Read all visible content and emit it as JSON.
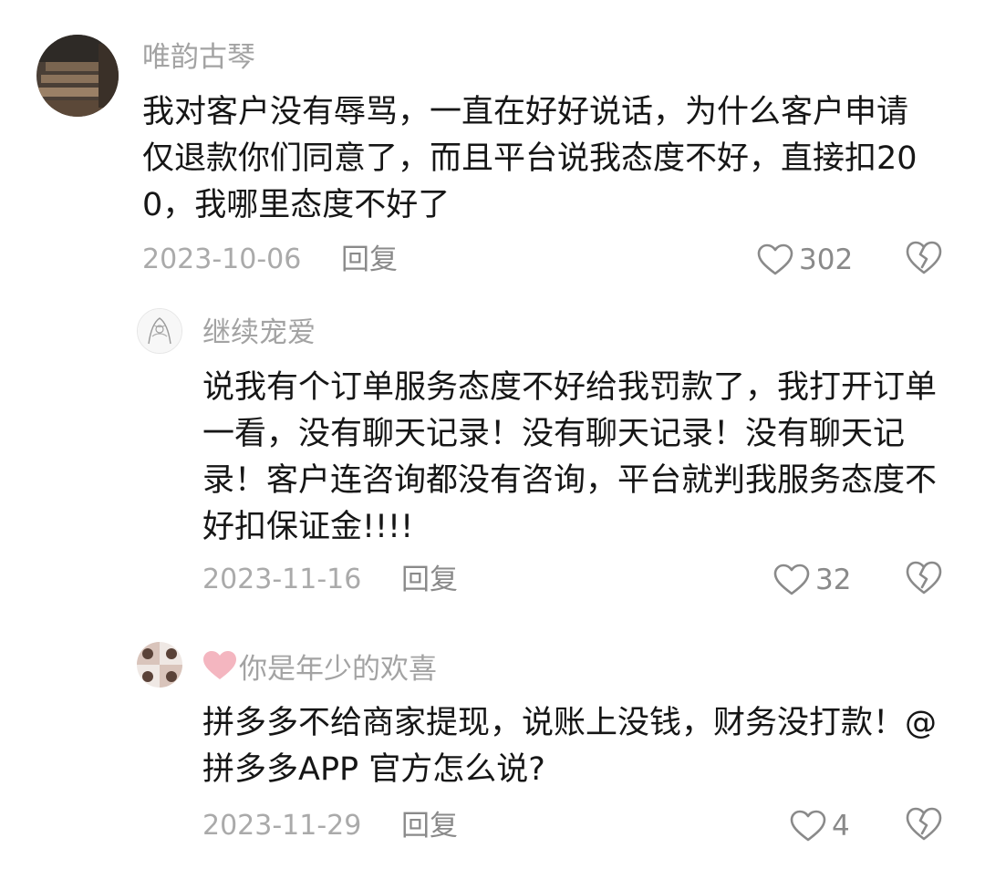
{
  "comments": [
    {
      "username": "唯韵古琴",
      "text": "我对客户没有辱骂，一直在好好说话，为什么客户申请仅退款你们同意了，而且平台说我态度不好，直接扣200，我哪里态度不好了",
      "date": "2023-10-06",
      "reply_label": "回复",
      "likes": "302"
    },
    {
      "username": "继续宠爱",
      "text": "说我有个订单服务态度不好给我罚款了，我打开订单一看，没有聊天记录！没有聊天记录！没有聊天记录！客户连咨询都没有咨询，平台就判我服务态度不好扣保证金!!!!",
      "date": "2023-11-16",
      "reply_label": "回复",
      "likes": "32"
    },
    {
      "username": "你是年少的欢喜",
      "text": "拼多多不给商家提现，说账上没钱，财务没打款！@拼多多APP 官方怎么说?",
      "date": "2023-11-29",
      "reply_label": "回复",
      "likes": "4"
    }
  ],
  "icons": {
    "like": "heart-outline-icon",
    "dislike": "broken-heart-icon",
    "name_prefix": "pink-heart-icon"
  },
  "colors": {
    "text": "#161616",
    "username": "#a3a3a3",
    "meta": "#aaaaaa",
    "icon": "#8a8a8a",
    "pink_heart": "#f4b6c0"
  }
}
